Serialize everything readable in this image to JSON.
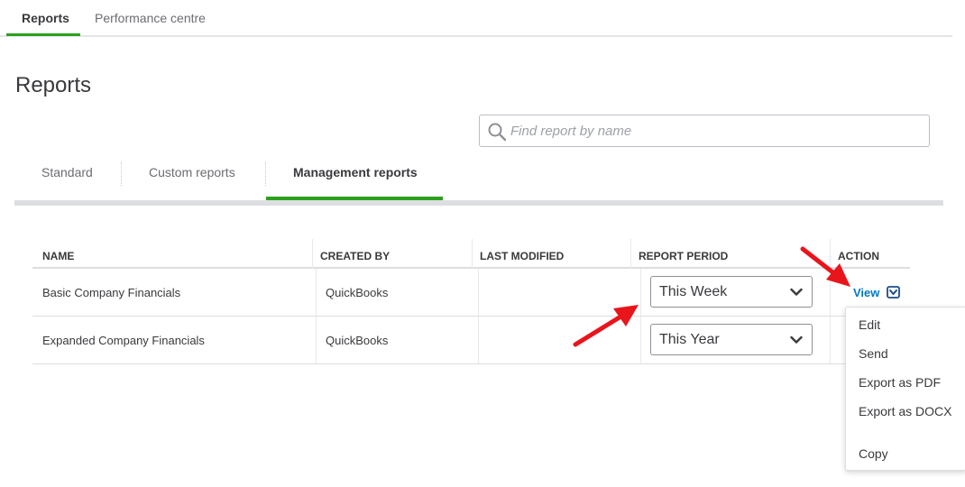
{
  "top_nav": {
    "tabs": [
      "Reports",
      "Performance centre"
    ],
    "active": "Reports"
  },
  "page": {
    "title": "Reports"
  },
  "search": {
    "placeholder": "Find report by name"
  },
  "sub_tabs": [
    "Standard",
    "Custom reports",
    "Management reports"
  ],
  "sub_tabs_active": "Management reports",
  "table": {
    "headers": [
      "NAME",
      "CREATED BY",
      "LAST MODIFIED",
      "REPORT PERIOD",
      "ACTION"
    ],
    "rows": [
      {
        "name": "Basic Company Financials",
        "created_by": "QuickBooks",
        "last_modified": "",
        "report_period": "This Week",
        "action": "View"
      },
      {
        "name": "Expanded Company Financials",
        "created_by": "QuickBooks",
        "last_modified": "",
        "report_period": "This Year",
        "action": ""
      }
    ]
  },
  "action_menu": {
    "items": [
      "Edit",
      "Send",
      "Export as PDF",
      "Export as DOCX",
      "Copy"
    ]
  },
  "colors": {
    "accent_green": "#2ca01c",
    "link_blue": "#0077c5",
    "annotation_red": "#e8151b"
  },
  "icons": {
    "search": "search-icon",
    "chevron": "chevron-down-icon",
    "action_caret": "caret-down-icon"
  }
}
